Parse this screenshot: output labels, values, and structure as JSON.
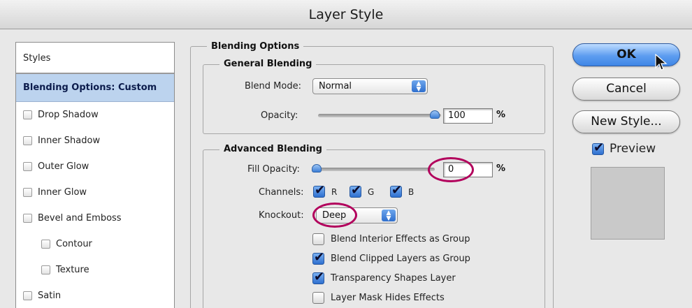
{
  "window": {
    "title": "Layer Style"
  },
  "styles_panel": {
    "header": "Styles",
    "items": [
      {
        "label": "Blending Options: Custom",
        "selected": true,
        "checkbox": false,
        "indent": false
      },
      {
        "label": "Drop Shadow",
        "selected": false,
        "checkbox": true,
        "indent": false
      },
      {
        "label": "Inner Shadow",
        "selected": false,
        "checkbox": true,
        "indent": false
      },
      {
        "label": "Outer Glow",
        "selected": false,
        "checkbox": true,
        "indent": false
      },
      {
        "label": "Inner Glow",
        "selected": false,
        "checkbox": true,
        "indent": false
      },
      {
        "label": "Bevel and Emboss",
        "selected": false,
        "checkbox": true,
        "indent": false
      },
      {
        "label": "Contour",
        "selected": false,
        "checkbox": true,
        "indent": true
      },
      {
        "label": "Texture",
        "selected": false,
        "checkbox": true,
        "indent": true
      },
      {
        "label": "Satin",
        "selected": false,
        "checkbox": true,
        "indent": false
      }
    ]
  },
  "blending_options": {
    "title": "Blending Options",
    "general": {
      "title": "General Blending",
      "blend_mode_label": "Blend Mode:",
      "blend_mode_value": "Normal",
      "opacity_label": "Opacity:",
      "opacity_value": "100",
      "opacity_unit": "%"
    },
    "advanced": {
      "title": "Advanced Blending",
      "fill_opacity_label": "Fill Opacity:",
      "fill_opacity_value": "0",
      "fill_opacity_unit": "%",
      "channels_label": "Channels:",
      "channels": [
        {
          "label": "R",
          "checked": true
        },
        {
          "label": "G",
          "checked": true
        },
        {
          "label": "B",
          "checked": true
        }
      ],
      "knockout_label": "Knockout:",
      "knockout_value": "Deep",
      "options": [
        {
          "label": "Blend Interior Effects as Group",
          "checked": false
        },
        {
          "label": "Blend Clipped Layers as Group",
          "checked": true
        },
        {
          "label": "Transparency Shapes Layer",
          "checked": true
        },
        {
          "label": "Layer Mask Hides Effects",
          "checked": false
        }
      ]
    }
  },
  "buttons": {
    "ok": "OK",
    "cancel": "Cancel",
    "new_style": "New Style...",
    "preview_label": "Preview",
    "preview_checked": true
  },
  "colors": {
    "highlight": "#b2005c",
    "selection": "#bcd3ee",
    "accent_blue": "#3f86e6"
  }
}
